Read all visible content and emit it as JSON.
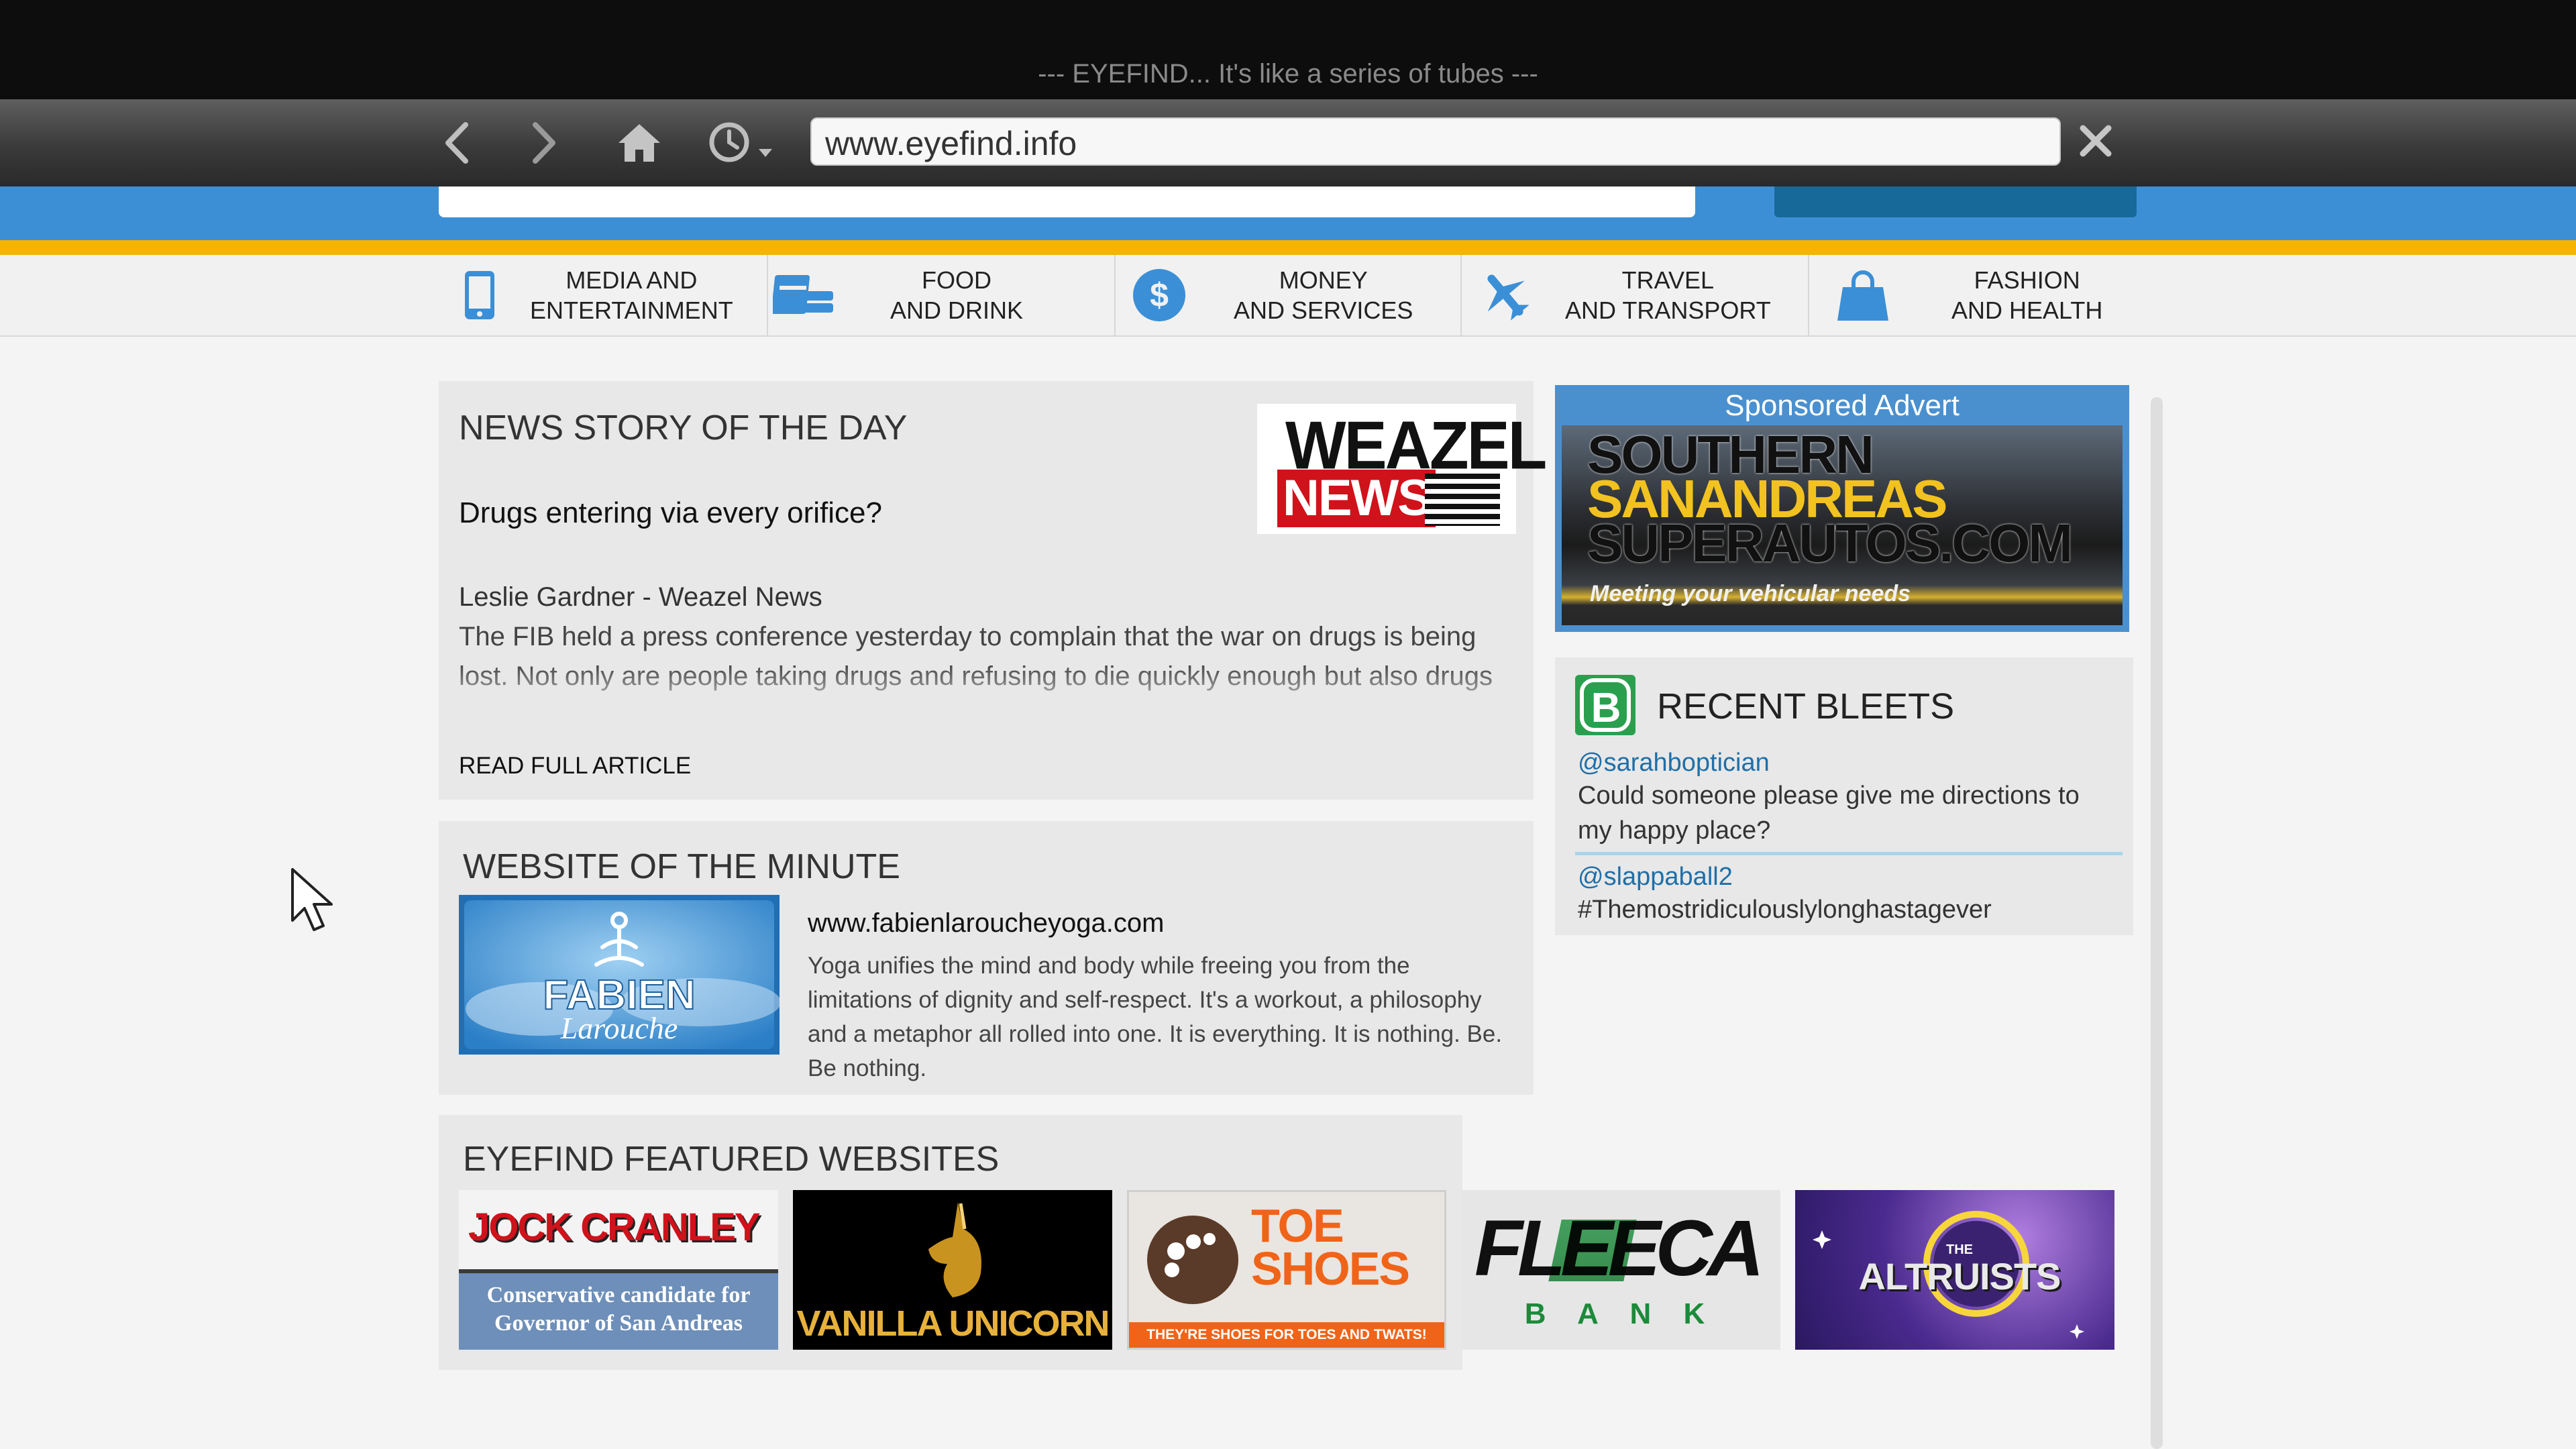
{
  "window": {
    "title": "--- EYEFIND... It's like a series of tubes ---"
  },
  "browser": {
    "url": "www.eyefind.info",
    "icons": [
      "back-arrow-icon",
      "forward-arrow-icon",
      "home-icon",
      "history-clock-icon",
      "close-icon"
    ]
  },
  "categories": [
    {
      "label": "MEDIA AND\nENTERTAINMENT",
      "icon": "phone-icon"
    },
    {
      "label": "FOOD\nAND DRINK",
      "icon": "food-icon"
    },
    {
      "label": "MONEY\nAND SERVICES",
      "icon": "dollar-icon"
    },
    {
      "label": "TRAVEL\nAND TRANSPORT",
      "icon": "plane-icon"
    },
    {
      "label": "FASHION\nAND HEALTH",
      "icon": "shopping-bag-icon"
    }
  ],
  "news": {
    "heading": "NEWS STORY OF THE DAY",
    "headline": "Drugs entering via every orifice?",
    "author": "Leslie Gardner - Weazel News",
    "body": "The FIB held a press conference yesterday to complain that the war on drugs is being lost. Not only are people taking drugs and refusing to die quickly enough but also drugs are entering the country through a bewildering number of ways.",
    "read_more": "READ FULL ARTICLE",
    "logo": {
      "line1": "WEAZEL",
      "line2": "NEWS"
    }
  },
  "website_of_minute": {
    "heading": "WEBSITE OF THE MINUTE",
    "url": "www.fabienlaroucheyoga.com",
    "description": "Yoga unifies the mind and body while freeing you from the limitations of dignity and self-respect. It's a workout, a philosophy and a metaphor all rolled into one. It is everything. It is nothing. Be. Be nothing.",
    "logo_line1": "FABIEN",
    "logo_line2": "Larouche"
  },
  "featured": {
    "heading": "EYEFIND FEATURED WEBSITES",
    "sites": [
      {
        "title": "JOCK CRANLEY",
        "subtitle": "Conservative candidate for Governor of San Andreas"
      },
      {
        "title": "VANILLA UNICORN"
      },
      {
        "title": "TOE SHOES",
        "tagline": "THEY'RE SHOES FOR TOES AND TWATS!"
      },
      {
        "title": "FLEECA",
        "subtitle": "B A N K"
      },
      {
        "title": "ALTRUISTS",
        "small": "THE"
      }
    ]
  },
  "sponsored": {
    "label": "Sponsored Advert",
    "line1": "SOUTHERN",
    "line2": "SANANDREAS",
    "line3": "SUPERAUTOS.COM",
    "tagline": "Meeting your vehicular needs"
  },
  "bleets": {
    "heading": "RECENT BLEETS",
    "icon_letter": "B",
    "items": [
      {
        "user": "@sarahboptician",
        "text": "Could someone please give me directions to my happy place?"
      },
      {
        "user": "@slappaball2",
        "text": "#Themostridiculouslylonghastagever"
      }
    ]
  },
  "colors": {
    "header_blue": "#3d8fd5",
    "accent_yellow": "#f4b400",
    "link_blue": "#1f6fa8"
  }
}
